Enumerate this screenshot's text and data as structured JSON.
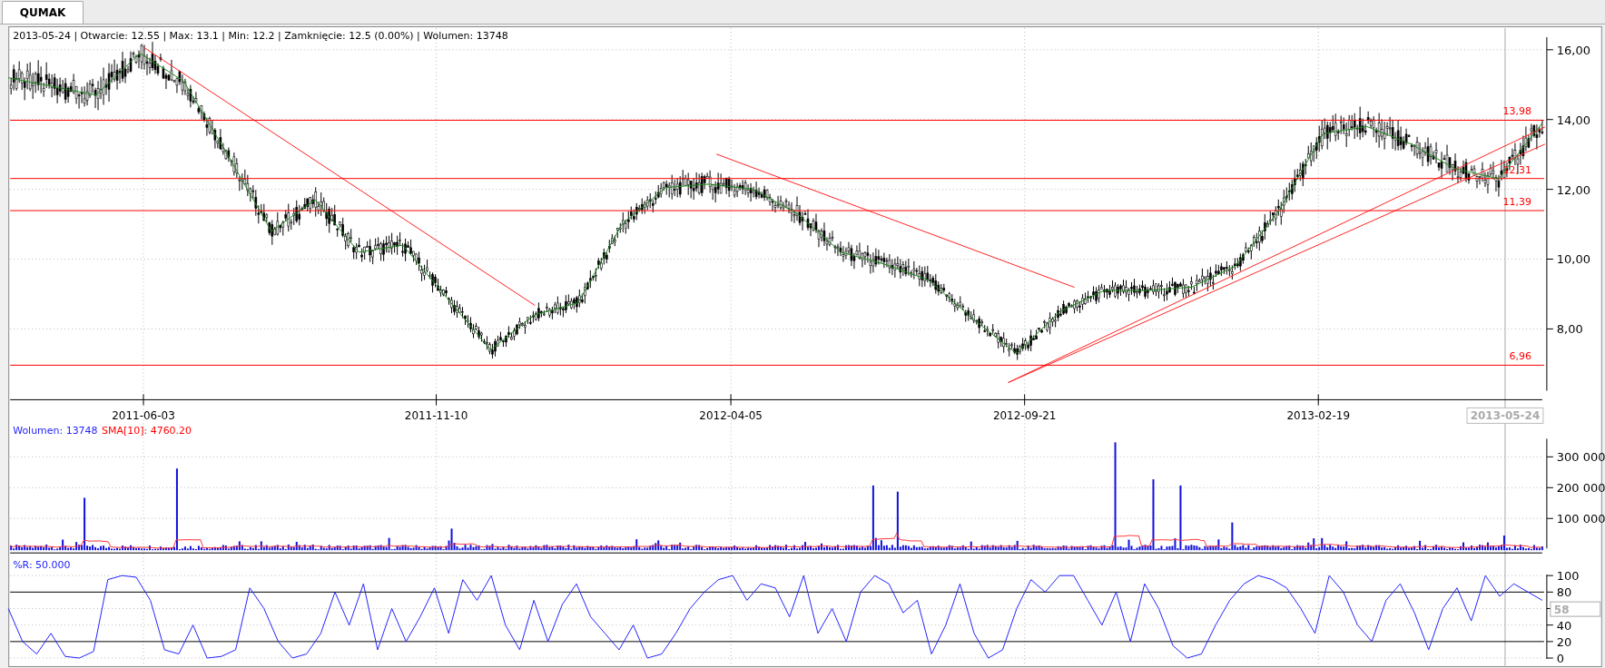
{
  "tabs": [
    {
      "label": "QUMAK",
      "selected": true
    }
  ],
  "price_panel": {
    "info": "2013-05-24 | Otwarcie: 12.55 | Max: 13.1 | Min: 12.2 | Zamknięcie: 12.5 (0.00%)  | Wolumen: 13748",
    "levels": [
      "13,98",
      "12,31",
      "11,39",
      "6,96"
    ],
    "dates": [
      "2011-06-03",
      "2011-11-10",
      "2012-04-05",
      "2012-09-21",
      "2013-02-19"
    ],
    "cursor_date": "2013-05-24",
    "chart_data": {
      "type": "line",
      "ylim": [
        6.23,
        16.36
      ],
      "yticks": [
        {
          "value": 16,
          "label": "16,00"
        },
        {
          "value": 14,
          "label": "14,00"
        },
        {
          "value": 12,
          "label": "12,00"
        },
        {
          "value": 10,
          "label": "10,00"
        },
        {
          "value": 8,
          "label": "8,00"
        }
      ],
      "series": [
        {
          "color": "#1a8a1a",
          "values": [
            15.2,
            14.95,
            14.7,
            15.9,
            15.1,
            13.0,
            10.8,
            11.7,
            10.2,
            10.4,
            8.9,
            7.4,
            8.4,
            8.75,
            11.0,
            12.05,
            12.15,
            12.0,
            11.3,
            10.2,
            9.85,
            9.4,
            8.3,
            7.3,
            8.5,
            9.1,
            9.1,
            9.2,
            9.8,
            11.4,
            13.6,
            13.8,
            13.3,
            12.6,
            12.3,
            13.9
          ]
        }
      ]
    }
  },
  "volume_panel": {
    "volume_label": "Wolumen: 13748",
    "sma_label": "SMA[10]: 4760.20",
    "yticks": [
      "300 000",
      "200 000",
      "100 000"
    ]
  },
  "r_panel": {
    "label": "%R: 50.000",
    "current_value": "58",
    "chart_data": {
      "type": "line",
      "ylim": [
        0,
        100
      ],
      "yticks": [
        {
          "value": 100,
          "label": "100"
        },
        {
          "value": 80,
          "label": "80"
        },
        {
          "value": 40,
          "label": "40"
        },
        {
          "value": 20,
          "label": "20"
        },
        {
          "value": 0,
          "label": "0"
        }
      ],
      "series": [
        {
          "color": "#2222ff",
          "values": [
            60,
            20,
            5,
            30,
            2,
            0,
            8,
            95,
            100,
            98,
            70,
            10,
            5,
            40,
            0,
            2,
            10,
            85,
            60,
            20,
            0,
            5,
            30,
            80,
            40,
            90,
            10,
            60,
            20,
            50,
            85,
            30,
            95,
            70,
            100,
            40,
            10,
            70,
            20,
            65,
            90,
            50,
            30,
            10,
            40,
            0,
            5,
            30,
            60,
            80,
            95,
            100,
            70,
            90,
            85,
            50,
            100,
            30,
            60,
            20,
            80,
            100,
            90,
            55,
            70,
            5,
            40,
            90,
            30,
            0,
            10,
            60,
            95,
            80,
            100,
            100,
            70,
            40,
            80,
            20,
            90,
            60,
            15,
            0,
            5,
            40,
            70,
            90,
            100,
            95,
            85,
            60,
            30,
            100,
            80,
            40,
            20,
            70,
            90,
            55,
            10,
            60,
            85,
            45,
            100,
            75,
            90,
            80,
            70
          ]
        }
      ]
    }
  }
}
